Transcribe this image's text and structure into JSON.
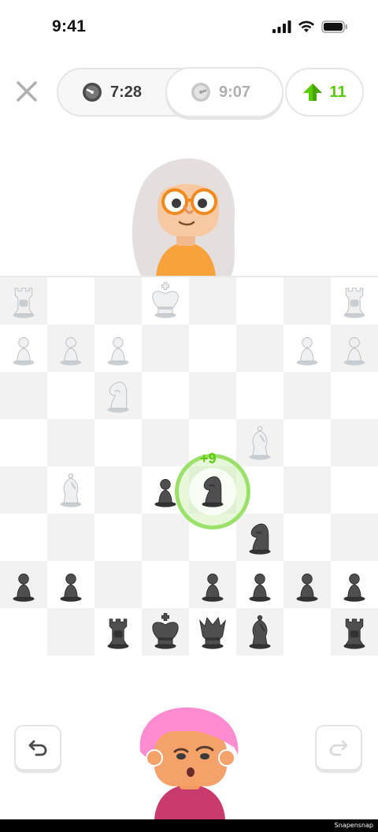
{
  "status_bar": {
    "time": "9:41"
  },
  "header": {
    "close_icon": "close-icon",
    "timers": [
      {
        "value": "7:28",
        "state": "active",
        "icon": "clock-icon"
      },
      {
        "value": "9:07",
        "state": "inactive",
        "icon": "clock-icon"
      }
    ],
    "score": {
      "value": "11",
      "icon": "up-arrow-icon",
      "color": "#58cc02"
    }
  },
  "board": {
    "light_color": "#ffffff",
    "dark_color": "#f2f2f2",
    "white_pieces": [
      {
        "type": "rook",
        "square": "a8"
      },
      {
        "type": "king",
        "square": "d8"
      },
      {
        "type": "rook",
        "square": "h8"
      },
      {
        "type": "pawn",
        "square": "a7"
      },
      {
        "type": "pawn",
        "square": "b7"
      },
      {
        "type": "pawn",
        "square": "c7"
      },
      {
        "type": "pawn",
        "square": "g7"
      },
      {
        "type": "pawn",
        "square": "h7"
      },
      {
        "type": "knight",
        "square": "c6"
      },
      {
        "type": "bishop",
        "square": "f5"
      },
      {
        "type": "bishop",
        "square": "b4"
      }
    ],
    "black_pieces": [
      {
        "type": "pawn",
        "square": "d4"
      },
      {
        "type": "knight",
        "square": "e4"
      },
      {
        "type": "knight",
        "square": "f3"
      },
      {
        "type": "pawn",
        "square": "a2"
      },
      {
        "type": "pawn",
        "square": "b2"
      },
      {
        "type": "pawn",
        "square": "e2"
      },
      {
        "type": "pawn",
        "square": "f2"
      },
      {
        "type": "pawn",
        "square": "g2"
      },
      {
        "type": "pawn",
        "square": "h2"
      },
      {
        "type": "rook",
        "square": "c1"
      },
      {
        "type": "king",
        "square": "d1"
      },
      {
        "type": "queen",
        "square": "e1"
      },
      {
        "type": "bishop",
        "square": "f1"
      },
      {
        "type": "rook",
        "square": "h1"
      }
    ],
    "highlight": {
      "square": "e4",
      "label": "+9"
    }
  },
  "opponent": {
    "avatar": "opponent-avatar"
  },
  "player": {
    "avatar": "player-avatar"
  },
  "controls": {
    "undo_icon": "undo-icon",
    "redo_icon": "redo-icon"
  },
  "watermark": "Snapensnap"
}
